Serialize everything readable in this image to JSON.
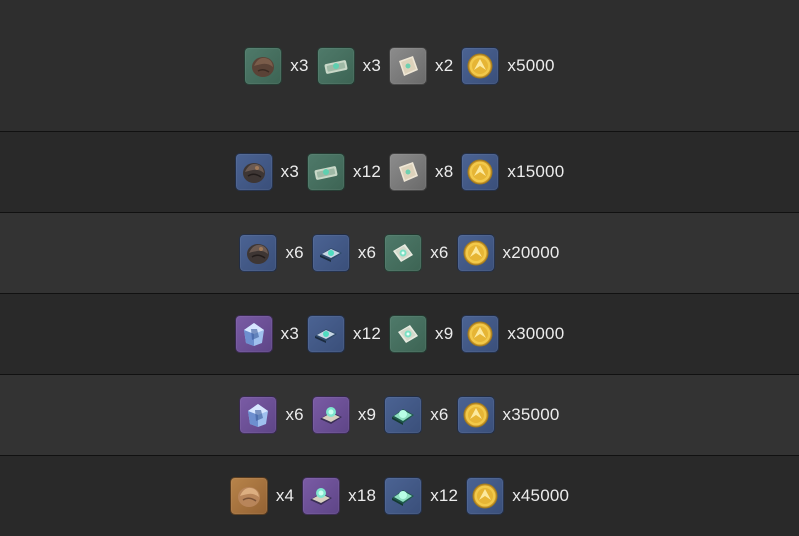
{
  "rows": [
    {
      "items": [
        {
          "icon": "brown-stone-icon",
          "rarity": "green",
          "qty": "x3"
        },
        {
          "icon": "scroll-bundle-icon",
          "rarity": "green",
          "qty": "x3"
        },
        {
          "icon": "parchment-icon",
          "rarity": "gray",
          "qty": "x2"
        },
        {
          "icon": "gold-coin-icon",
          "rarity": "blue",
          "qty": "x5000"
        }
      ]
    },
    {
      "items": [
        {
          "icon": "dark-stone-icon",
          "rarity": "blue",
          "qty": "x3"
        },
        {
          "icon": "scroll-bundle-icon",
          "rarity": "green",
          "qty": "x12"
        },
        {
          "icon": "parchment-icon",
          "rarity": "gray",
          "qty": "x8"
        },
        {
          "icon": "gold-coin-icon",
          "rarity": "blue",
          "qty": "x15000"
        }
      ]
    },
    {
      "items": [
        {
          "icon": "dark-stone-icon",
          "rarity": "blue",
          "qty": "x6"
        },
        {
          "icon": "tome-icon",
          "rarity": "blue",
          "qty": "x6"
        },
        {
          "icon": "parchment-gem-icon",
          "rarity": "green",
          "qty": "x6"
        },
        {
          "icon": "gold-coin-icon",
          "rarity": "blue",
          "qty": "x20000"
        }
      ]
    },
    {
      "items": [
        {
          "icon": "crystal-stone-icon",
          "rarity": "purple",
          "qty": "x3"
        },
        {
          "icon": "tome-icon",
          "rarity": "blue",
          "qty": "x12"
        },
        {
          "icon": "parchment-gem-icon",
          "rarity": "green",
          "qty": "x9"
        },
        {
          "icon": "gold-coin-icon",
          "rarity": "blue",
          "qty": "x30000"
        }
      ]
    },
    {
      "items": [
        {
          "icon": "crystal-stone-icon",
          "rarity": "purple",
          "qty": "x6"
        },
        {
          "icon": "ornate-tome-icon",
          "rarity": "purple",
          "qty": "x9"
        },
        {
          "icon": "jade-tablet-icon",
          "rarity": "blue",
          "qty": "x6"
        },
        {
          "icon": "gold-coin-icon",
          "rarity": "blue",
          "qty": "x35000"
        }
      ]
    },
    {
      "items": [
        {
          "icon": "golden-stone-icon",
          "rarity": "orange",
          "qty": "x4"
        },
        {
          "icon": "ornate-tome-icon",
          "rarity": "purple",
          "qty": "x18"
        },
        {
          "icon": "jade-tablet-icon",
          "rarity": "blue",
          "qty": "x12"
        },
        {
          "icon": "gold-coin-icon",
          "rarity": "blue",
          "qty": "x45000"
        }
      ]
    }
  ]
}
